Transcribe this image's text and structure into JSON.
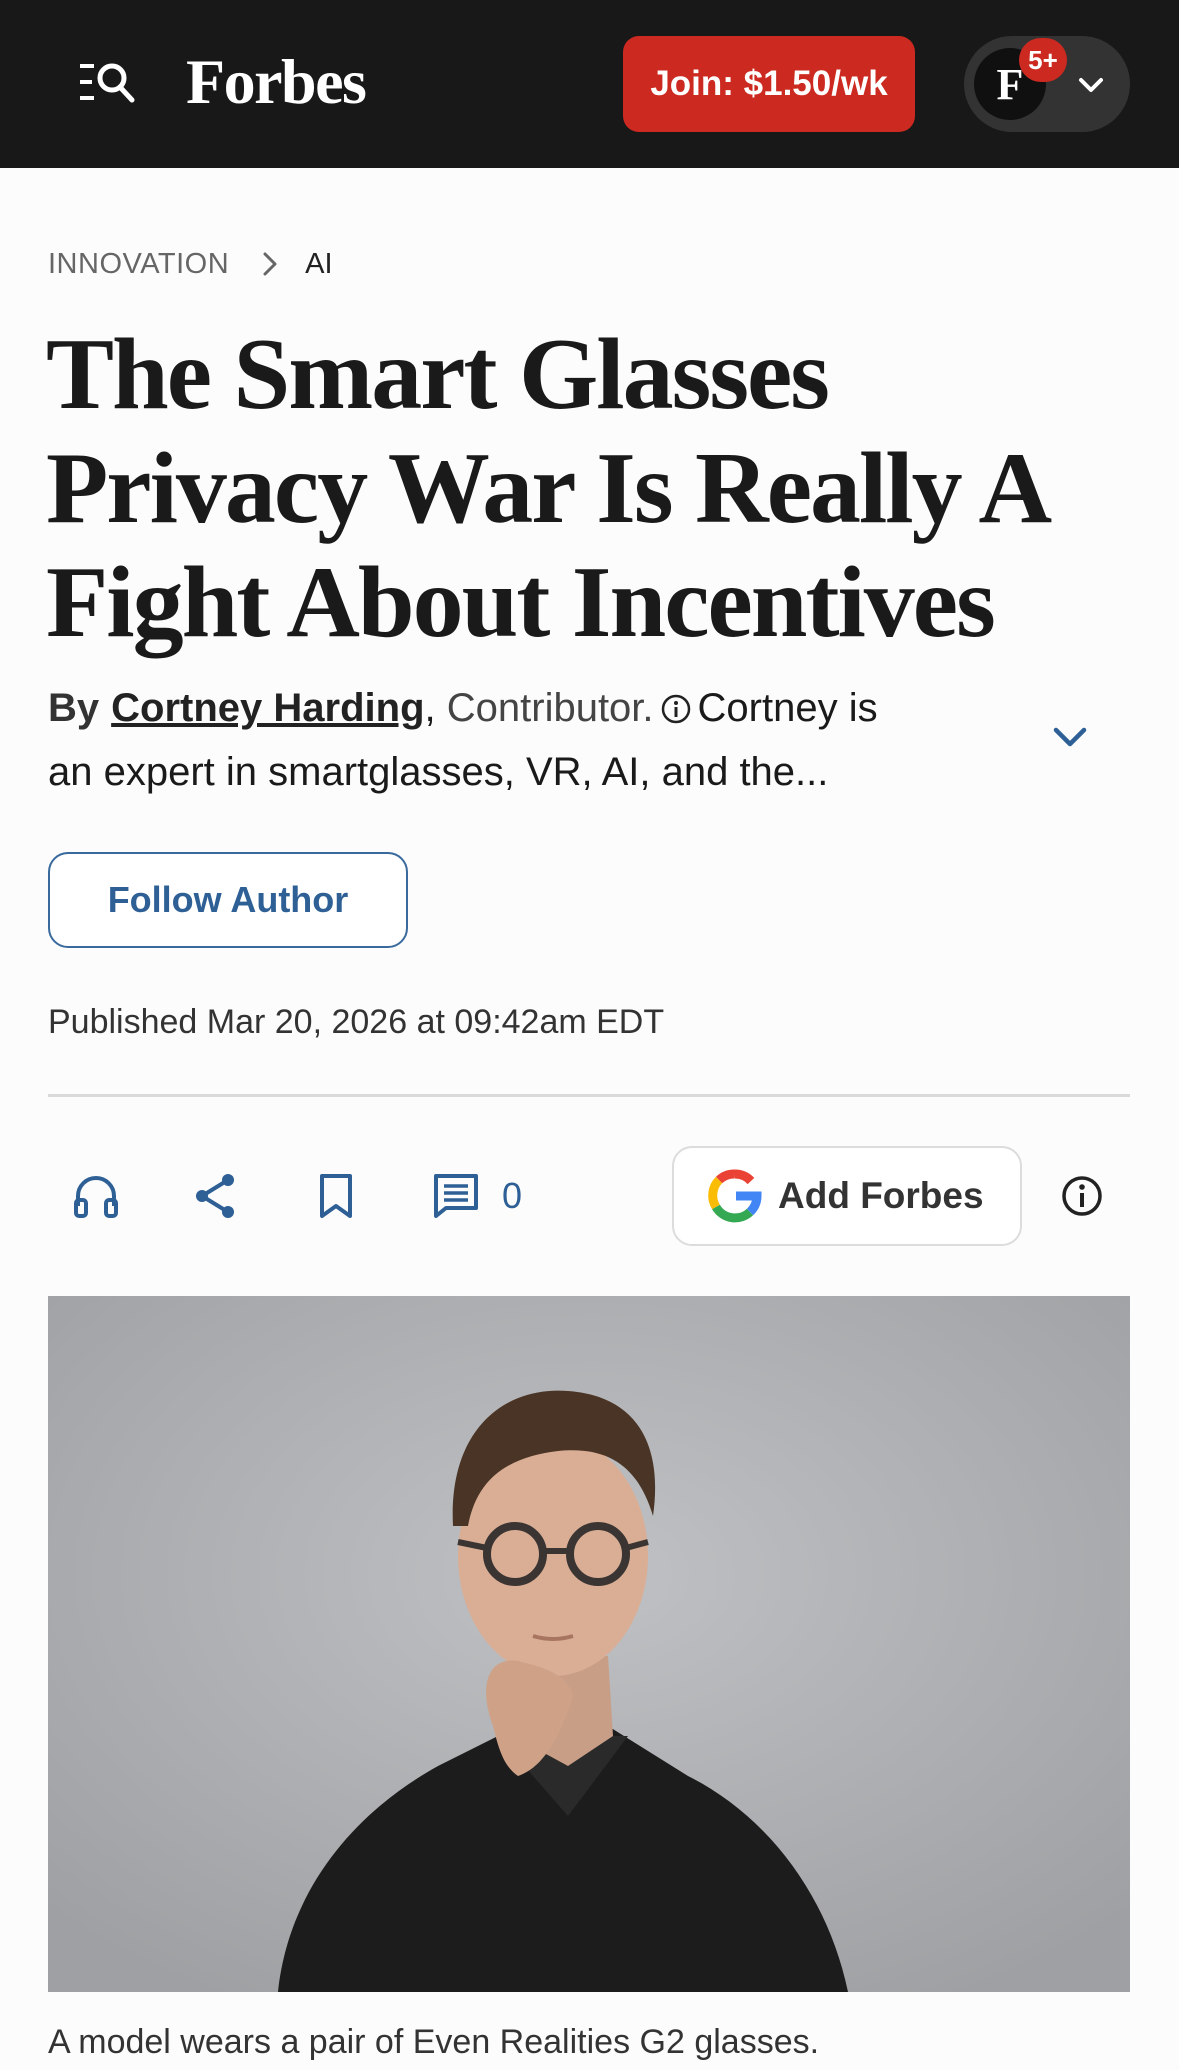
{
  "header": {
    "logo": "Forbes",
    "join_label": "Join: $1.50/wk",
    "avatar_letter": "F",
    "notification_count": "5+",
    "icons": [
      "menu-search-icon",
      "chevron-down-icon"
    ]
  },
  "breadcrumb": {
    "section": "INNOVATION",
    "subsection": "AI"
  },
  "article": {
    "title": "The Smart Glasses Privacy War Is Really A Fight About Incentives",
    "byline": {
      "by": "By",
      "author": "Cortney Harding",
      "comma": ",",
      "role": "Contributor.",
      "bio_start": "Cortney is",
      "bio_rest": "an expert in smartglasses, VR, AI, and the..."
    },
    "follow_label": "Follow Author",
    "published": "Published Mar 20, 2026 at 09:42am EDT",
    "comment_count": "0",
    "add_forbes_label": "Add Forbes",
    "caption": "A model wears a pair of Even Realities G2 glasses."
  },
  "actions": [
    "headphones-icon",
    "share-icon",
    "bookmark-icon",
    "comment-icon",
    "google-icon",
    "info-icon"
  ],
  "colors": {
    "header_bg": "#181818",
    "join_red": "#cc2a21",
    "link_blue": "#2e6096"
  }
}
